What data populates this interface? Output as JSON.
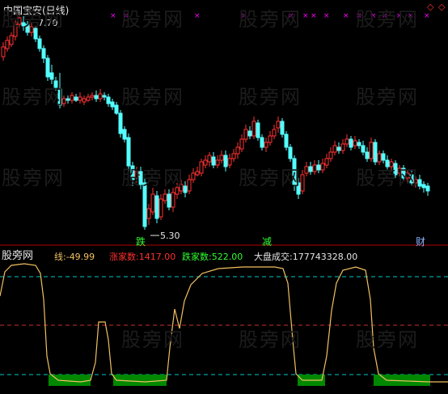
{
  "top": {
    "title": "中国宝安(日线)",
    "diamond_icon": "diamond-outline-icon",
    "high_label": "7.70",
    "low_label": "5.30",
    "signal_labels": [
      "跌",
      "减",
      "财"
    ]
  },
  "indicator": {
    "line_label": "线:",
    "line_value": "-49.99",
    "up_label": "涨家数:",
    "up_value": "1417.00",
    "down_label": "跌家数:",
    "down_value": "522.00",
    "volume_label": "大盘成交:",
    "volume_value": "177743328.00"
  },
  "watermarks": [
    "股旁网"
  ],
  "colors": {
    "background": "#000000",
    "up_candle": "#ff3232",
    "down_candle": "#54ffff",
    "divider": "#b40000",
    "marker": "#ff00ff",
    "osc_line": "#f0c060",
    "osc_fill": "#008800",
    "dash_green": "#00c8c8",
    "dash_red": "#c83232"
  }
}
